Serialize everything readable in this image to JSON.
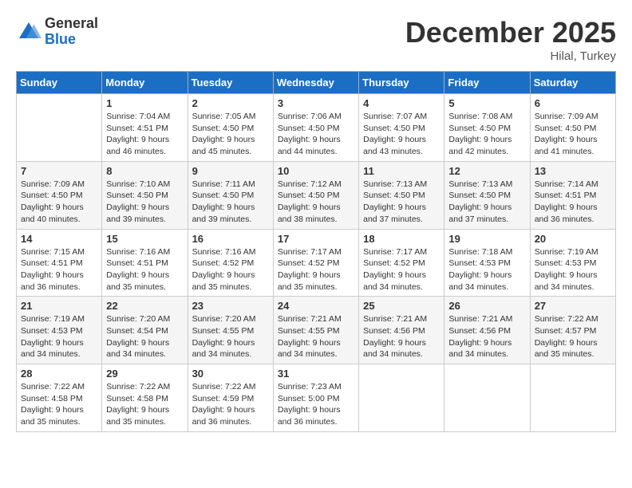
{
  "logo": {
    "general": "General",
    "blue": "Blue"
  },
  "title": "December 2025",
  "location": "Hilal, Turkey",
  "days_of_week": [
    "Sunday",
    "Monday",
    "Tuesday",
    "Wednesday",
    "Thursday",
    "Friday",
    "Saturday"
  ],
  "weeks": [
    [
      {
        "day": "",
        "info": ""
      },
      {
        "day": "1",
        "info": "Sunrise: 7:04 AM\nSunset: 4:51 PM\nDaylight: 9 hours\nand 46 minutes."
      },
      {
        "day": "2",
        "info": "Sunrise: 7:05 AM\nSunset: 4:50 PM\nDaylight: 9 hours\nand 45 minutes."
      },
      {
        "day": "3",
        "info": "Sunrise: 7:06 AM\nSunset: 4:50 PM\nDaylight: 9 hours\nand 44 minutes."
      },
      {
        "day": "4",
        "info": "Sunrise: 7:07 AM\nSunset: 4:50 PM\nDaylight: 9 hours\nand 43 minutes."
      },
      {
        "day": "5",
        "info": "Sunrise: 7:08 AM\nSunset: 4:50 PM\nDaylight: 9 hours\nand 42 minutes."
      },
      {
        "day": "6",
        "info": "Sunrise: 7:09 AM\nSunset: 4:50 PM\nDaylight: 9 hours\nand 41 minutes."
      }
    ],
    [
      {
        "day": "7",
        "info": "Sunrise: 7:09 AM\nSunset: 4:50 PM\nDaylight: 9 hours\nand 40 minutes."
      },
      {
        "day": "8",
        "info": "Sunrise: 7:10 AM\nSunset: 4:50 PM\nDaylight: 9 hours\nand 39 minutes."
      },
      {
        "day": "9",
        "info": "Sunrise: 7:11 AM\nSunset: 4:50 PM\nDaylight: 9 hours\nand 39 minutes."
      },
      {
        "day": "10",
        "info": "Sunrise: 7:12 AM\nSunset: 4:50 PM\nDaylight: 9 hours\nand 38 minutes."
      },
      {
        "day": "11",
        "info": "Sunrise: 7:13 AM\nSunset: 4:50 PM\nDaylight: 9 hours\nand 37 minutes."
      },
      {
        "day": "12",
        "info": "Sunrise: 7:13 AM\nSunset: 4:50 PM\nDaylight: 9 hours\nand 37 minutes."
      },
      {
        "day": "13",
        "info": "Sunrise: 7:14 AM\nSunset: 4:51 PM\nDaylight: 9 hours\nand 36 minutes."
      }
    ],
    [
      {
        "day": "14",
        "info": "Sunrise: 7:15 AM\nSunset: 4:51 PM\nDaylight: 9 hours\nand 36 minutes."
      },
      {
        "day": "15",
        "info": "Sunrise: 7:16 AM\nSunset: 4:51 PM\nDaylight: 9 hours\nand 35 minutes."
      },
      {
        "day": "16",
        "info": "Sunrise: 7:16 AM\nSunset: 4:52 PM\nDaylight: 9 hours\nand 35 minutes."
      },
      {
        "day": "17",
        "info": "Sunrise: 7:17 AM\nSunset: 4:52 PM\nDaylight: 9 hours\nand 35 minutes."
      },
      {
        "day": "18",
        "info": "Sunrise: 7:17 AM\nSunset: 4:52 PM\nDaylight: 9 hours\nand 34 minutes."
      },
      {
        "day": "19",
        "info": "Sunrise: 7:18 AM\nSunset: 4:53 PM\nDaylight: 9 hours\nand 34 minutes."
      },
      {
        "day": "20",
        "info": "Sunrise: 7:19 AM\nSunset: 4:53 PM\nDaylight: 9 hours\nand 34 minutes."
      }
    ],
    [
      {
        "day": "21",
        "info": "Sunrise: 7:19 AM\nSunset: 4:53 PM\nDaylight: 9 hours\nand 34 minutes."
      },
      {
        "day": "22",
        "info": "Sunrise: 7:20 AM\nSunset: 4:54 PM\nDaylight: 9 hours\nand 34 minutes."
      },
      {
        "day": "23",
        "info": "Sunrise: 7:20 AM\nSunset: 4:55 PM\nDaylight: 9 hours\nand 34 minutes."
      },
      {
        "day": "24",
        "info": "Sunrise: 7:21 AM\nSunset: 4:55 PM\nDaylight: 9 hours\nand 34 minutes."
      },
      {
        "day": "25",
        "info": "Sunrise: 7:21 AM\nSunset: 4:56 PM\nDaylight: 9 hours\nand 34 minutes."
      },
      {
        "day": "26",
        "info": "Sunrise: 7:21 AM\nSunset: 4:56 PM\nDaylight: 9 hours\nand 34 minutes."
      },
      {
        "day": "27",
        "info": "Sunrise: 7:22 AM\nSunset: 4:57 PM\nDaylight: 9 hours\nand 35 minutes."
      }
    ],
    [
      {
        "day": "28",
        "info": "Sunrise: 7:22 AM\nSunset: 4:58 PM\nDaylight: 9 hours\nand 35 minutes."
      },
      {
        "day": "29",
        "info": "Sunrise: 7:22 AM\nSunset: 4:58 PM\nDaylight: 9 hours\nand 35 minutes."
      },
      {
        "day": "30",
        "info": "Sunrise: 7:22 AM\nSunset: 4:59 PM\nDaylight: 9 hours\nand 36 minutes."
      },
      {
        "day": "31",
        "info": "Sunrise: 7:23 AM\nSunset: 5:00 PM\nDaylight: 9 hours\nand 36 minutes."
      },
      {
        "day": "",
        "info": ""
      },
      {
        "day": "",
        "info": ""
      },
      {
        "day": "",
        "info": ""
      }
    ]
  ]
}
